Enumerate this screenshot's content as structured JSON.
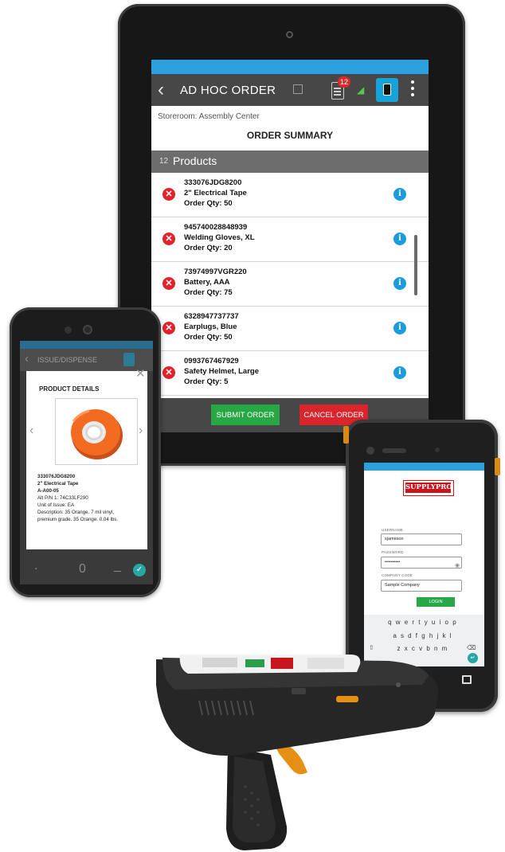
{
  "tablet": {
    "title": "AD HOC ORDER",
    "notification_count": "12",
    "storeroom": "Storeroom: Assembly Center",
    "summary_heading": "ORDER SUMMARY",
    "products_count": "12",
    "products_label": "Products",
    "items": [
      {
        "part": "333076JDG8200",
        "name": "2\" Electrical Tape",
        "qty": "Order Qty: 50"
      },
      {
        "part": "945740028848939",
        "name": "Welding Gloves, XL",
        "qty": "Order Qty: 20"
      },
      {
        "part": "73974997VGR220",
        "name": "Battery, AAA",
        "qty": "Order Qty: 75"
      },
      {
        "part": "6328947737737",
        "name": "Earplugs, Blue",
        "qty": "Order Qty: 50"
      },
      {
        "part": "0993767467929",
        "name": "Safety Helmet, Large",
        "qty": "Order Qty: 5"
      }
    ],
    "submit_label": "SUBMIT ORDER",
    "cancel_label": "CANCEL ORDER"
  },
  "phone": {
    "title": "ISSUE/DISPENSE",
    "dialog_title": "PRODUCT DETAILS",
    "part": "333076JDG8200",
    "name": "2\" Electrical Tape",
    "location": "A-A00-05",
    "alt_pn": "Alt P/N 1: 74C33LF290",
    "unit": "Unit of Issue: EA",
    "description_1": "Description: 35 Orange. 7 mil vinyl,",
    "description_2": "premium grade. 35 Orange. 0.04 lbs.",
    "nav_zero": "0"
  },
  "rugged": {
    "logo": "SUPPLYPRO",
    "username_label": "USERNAME",
    "username_value": "sjameson",
    "password_label": "PASSWORD",
    "password_value": "••••••••••",
    "company_label": "COMPANY CODE",
    "company_value": "Sample Company",
    "login_label": "LOGIN",
    "keyboard_row1": "qwertyuiop",
    "keyboard_row2": "asdfghjkl",
    "keyboard_row3": "zxcvbnm"
  },
  "colors": {
    "accent_blue": "#2aa0de",
    "app_bar": "#474747",
    "submit_green": "#27a844",
    "cancel_red": "#d9262c",
    "tape_orange": "#f36b21"
  }
}
